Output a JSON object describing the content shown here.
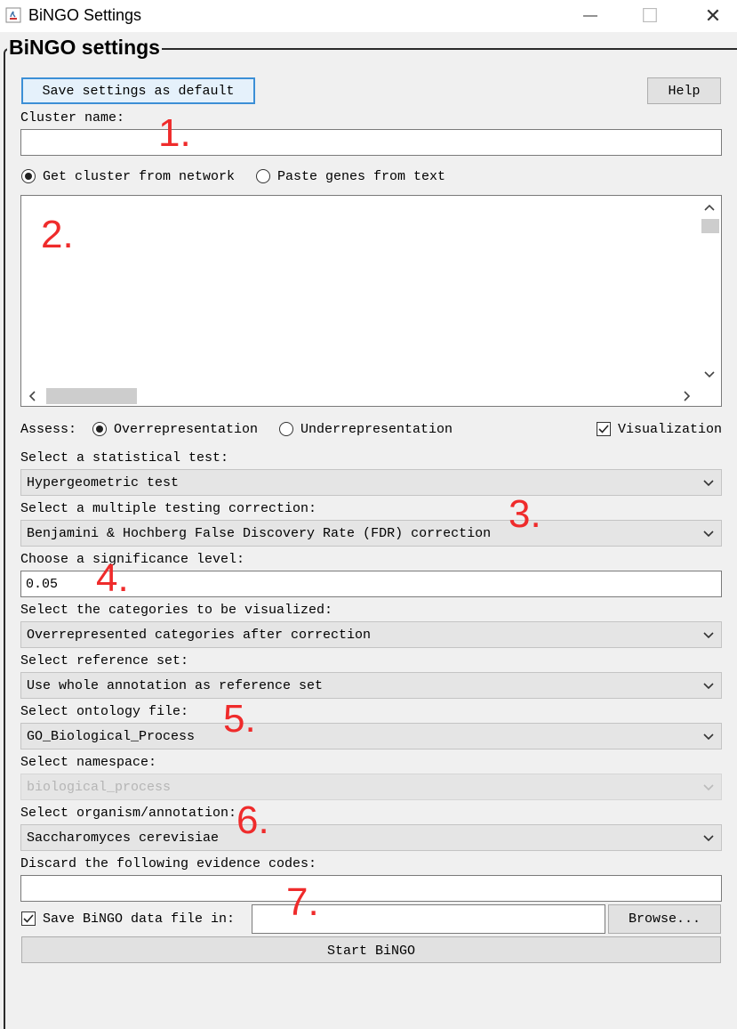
{
  "window": {
    "title": "BiNGO Settings",
    "min_glyph": "—",
    "max_glyph": "☐",
    "close_glyph": "✕"
  },
  "panel_title": "BiNGO settings",
  "buttons": {
    "save_default": "Save settings as default",
    "help": "Help",
    "browse": "Browse...",
    "start": "Start BiNGO"
  },
  "cluster": {
    "label": "Cluster name:",
    "value": ""
  },
  "source": {
    "option_network": "Get cluster from network",
    "option_paste": "Paste genes from text",
    "selected": "network"
  },
  "assess": {
    "label": "Assess:",
    "over": "Overrepresentation",
    "under": "Underrepresentation",
    "selected": "over",
    "visualization_label": "Visualization",
    "visualization_checked": true
  },
  "fields": {
    "stat_test": {
      "label": "Select a statistical test:",
      "value": "Hypergeometric test"
    },
    "correction": {
      "label": "Select a multiple testing correction:",
      "value": "Benjamini & Hochberg False Discovery Rate (FDR) correction"
    },
    "significance": {
      "label": "Choose a significance level:",
      "value": "0.05"
    },
    "categories": {
      "label": "Select the categories to be visualized:",
      "value": "Overrepresented categories after correction"
    },
    "reference": {
      "label": "Select reference set:",
      "value": "Use whole annotation as reference set"
    },
    "ontology": {
      "label": "Select ontology file:",
      "value": "GO_Biological_Process"
    },
    "namespace": {
      "label": "Select namespace:",
      "value": "biological_process"
    },
    "organism": {
      "label": "Select organism/annotation:",
      "value": "Saccharomyces cerevisiae"
    },
    "evidence": {
      "label": "Discard the following evidence codes:",
      "value": ""
    }
  },
  "save_file": {
    "label": "Save BiNGO data file in:",
    "checked": true,
    "value": ""
  },
  "annotations": [
    "1.",
    "2.",
    "3.",
    "4.",
    "5.",
    "6.",
    "7."
  ],
  "colors": {
    "annotation": "#ef2b2b",
    "background": "#f0f0f0"
  }
}
